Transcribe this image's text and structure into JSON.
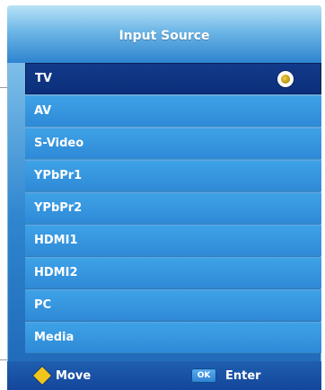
{
  "menu": {
    "title": "Input Source",
    "items": [
      {
        "label": "TV",
        "selected": true
      },
      {
        "label": "AV",
        "selected": false
      },
      {
        "label": "S-Video",
        "selected": false
      },
      {
        "label": "YPbPr1",
        "selected": false
      },
      {
        "label": "YPbPr2",
        "selected": false
      },
      {
        "label": "HDMI1",
        "selected": false
      },
      {
        "label": "HDMI2",
        "selected": false
      },
      {
        "label": "PC",
        "selected": false
      },
      {
        "label": "Media",
        "selected": false
      }
    ],
    "selected_indicator_icon": "radio-selected-icon"
  },
  "footer": {
    "move_label": "Move",
    "move_icon": "diamond-navigation-icon",
    "ok_key_label": "OK",
    "enter_label": "Enter"
  },
  "colors": {
    "selected_row": "#0b2f7a",
    "row": "#3ea2e6",
    "footer": "#14469a",
    "move_icon": "#f2c51b"
  }
}
